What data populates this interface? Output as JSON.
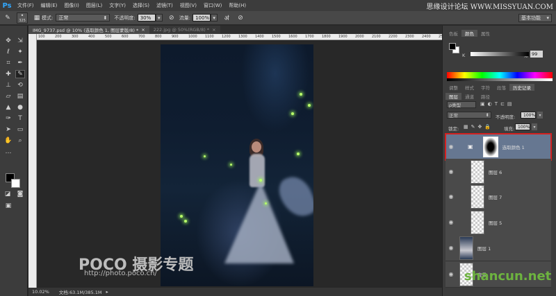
{
  "app": {
    "logo": "Ps",
    "watermark_top": "思缘设计论坛 WWW.MISSYUAN.COM"
  },
  "menu": [
    "文件(F)",
    "编辑(E)",
    "图像(I)",
    "图层(L)",
    "文字(Y)",
    "选择(S)",
    "滤镜(T)",
    "视图(V)",
    "窗口(W)",
    "帮助(H)"
  ],
  "options": {
    "brush_size": "325",
    "mode_label": "模式:",
    "mode_value": "正常",
    "opacity_label": "不透明度:",
    "opacity_value": "30%",
    "flow_label": "流量:",
    "flow_value": "100%"
  },
  "workspace": "基本功能",
  "doc_tabs": [
    {
      "label": "IMG_9737.psd @ 10% (选取颜色 1, 图层蒙版/8) *",
      "active": true
    },
    {
      "label": "222.jpg @ 50%(RGB/8) *",
      "active": false
    }
  ],
  "ruler_ticks": [
    "100",
    "200",
    "300",
    "400",
    "500",
    "600",
    "700",
    "800",
    "900",
    "1000",
    "1100",
    "1200",
    "1300",
    "1400",
    "1500",
    "1600",
    "1700",
    "1800",
    "1900",
    "2000",
    "2100",
    "2200",
    "2300",
    "2400",
    "2500"
  ],
  "canvas_watermark": {
    "logo": "POCO 摄影专题",
    "url": "http://photo.poco.cn/"
  },
  "status": {
    "zoom": "10.02%",
    "doc": "文档:63.1M/385.1M"
  },
  "color_panel": {
    "tabs": [
      "色板",
      "颜色",
      "属性"
    ],
    "active_tab": 1,
    "channel": "K",
    "k_value": "99",
    "percent": "%"
  },
  "mid_tabs": [
    "调整",
    "样式",
    "字符",
    "段落",
    "历史记录"
  ],
  "layers_panel": {
    "tabs": [
      "图层",
      "通道",
      "路径"
    ],
    "filter_label": "ρ类型",
    "blend_mode": "正常",
    "opacity_label": "不透明度:",
    "opacity_value": "100%",
    "lock_label": "锁定:",
    "fill_label": "填充:",
    "fill_value": "100%",
    "layers": [
      {
        "name": "选取颜色 1",
        "selected": true
      },
      {
        "name": "图层 6",
        "selected": false
      },
      {
        "name": "图层 7",
        "selected": false
      },
      {
        "name": "图层 5",
        "selected": false
      },
      {
        "name": "图层 1",
        "selected": false
      },
      {
        "name": "背景",
        "selected": false
      }
    ]
  },
  "shancun_watermark": "shancun.net",
  "colors": {
    "selection_outline": "#d42020",
    "selected_layer": "#667791",
    "firefly": "#b9ff6a"
  }
}
